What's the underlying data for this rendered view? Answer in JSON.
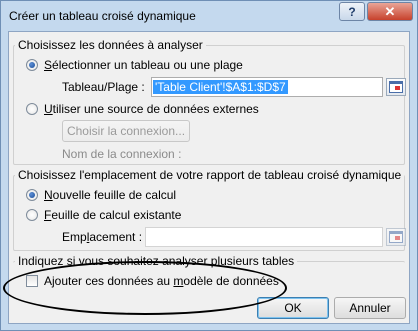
{
  "window": {
    "title": "Créer un tableau croisé dynamique",
    "help_button": "?",
    "close_button": "✕"
  },
  "section_data": {
    "legend": "Choisissez les données à analyser",
    "option_table": {
      "accel": "S",
      "label_rest": "électionner un tableau ou une plage",
      "selected": true
    },
    "table_range": {
      "label": "Tableau/Plage :",
      "value": "'Table Client'!$A$1:$D$7"
    },
    "option_external": {
      "accel": "U",
      "label_rest": "tiliser une source de données externes",
      "selected": false
    },
    "choose_connection_button": "Choisir la connexion...",
    "connection_name_label": "Nom de la connexion :"
  },
  "section_location": {
    "legend": "Choisissez l'emplacement de votre rapport de tableau croisé dynamique",
    "option_new": {
      "accel": "N",
      "label_rest": "ouvelle feuille de calcul",
      "selected": true
    },
    "option_existing": {
      "accel": "F",
      "label_rest": "euille de calcul existante",
      "selected": false
    },
    "location_label_pre": "Emp",
    "location_label_accel": "l",
    "location_label_post": "acement :",
    "location_value": ""
  },
  "section_multi": {
    "legend": "Indiquez si vous souhaitez analyser plusieurs tables",
    "checkbox_pre": "Ajouter ces données au ",
    "checkbox_accel": "m",
    "checkbox_post": "odèle de données",
    "checked": false
  },
  "buttons": {
    "ok": "OK",
    "cancel": "Annuler"
  },
  "colors": {
    "selection_highlight": "#3399ff",
    "window_frame": "#c4d9ee",
    "close_button": "#c7412c"
  },
  "icons": {
    "help": "question-mark",
    "close": "x",
    "range_picker": "collapse-dialog-icon"
  }
}
